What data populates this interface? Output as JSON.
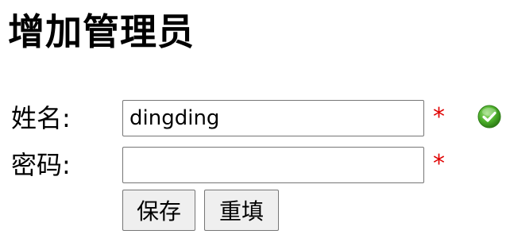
{
  "page": {
    "title": "增加管理员"
  },
  "form": {
    "name": {
      "label": "姓名:",
      "value": "dingding",
      "required_mark": "*",
      "status": "valid"
    },
    "password": {
      "label": "密码:",
      "value": "",
      "required_mark": "*"
    },
    "actions": {
      "save_label": "保存",
      "reset_label": "重填"
    }
  },
  "colors": {
    "required": "#e00000",
    "valid_icon": "#4caf2a"
  }
}
